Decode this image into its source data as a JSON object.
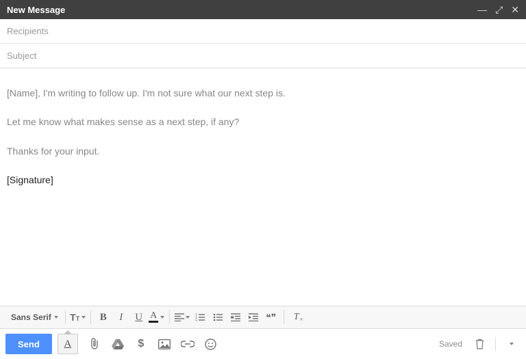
{
  "titlebar": {
    "title": "New Message"
  },
  "fields": {
    "recipients_placeholder": "Recipients",
    "subject_placeholder": "Subject"
  },
  "body": {
    "p1": "[Name], I'm writing to follow up. I'm not sure what our next step is.",
    "p2": "Let me know what makes sense as a next step, if any?",
    "p3": "Thanks for your input.",
    "signature": "[Signature]"
  },
  "fmt": {
    "font_name": "Sans Serif",
    "size_big": "T",
    "size_small": "T",
    "bold": "B",
    "italic": "I",
    "underline": "U",
    "color": "A",
    "quote": "❝❞",
    "clear": "T"
  },
  "actions": {
    "send": "Send",
    "fmt_toggle": "A",
    "saved": "Saved"
  }
}
